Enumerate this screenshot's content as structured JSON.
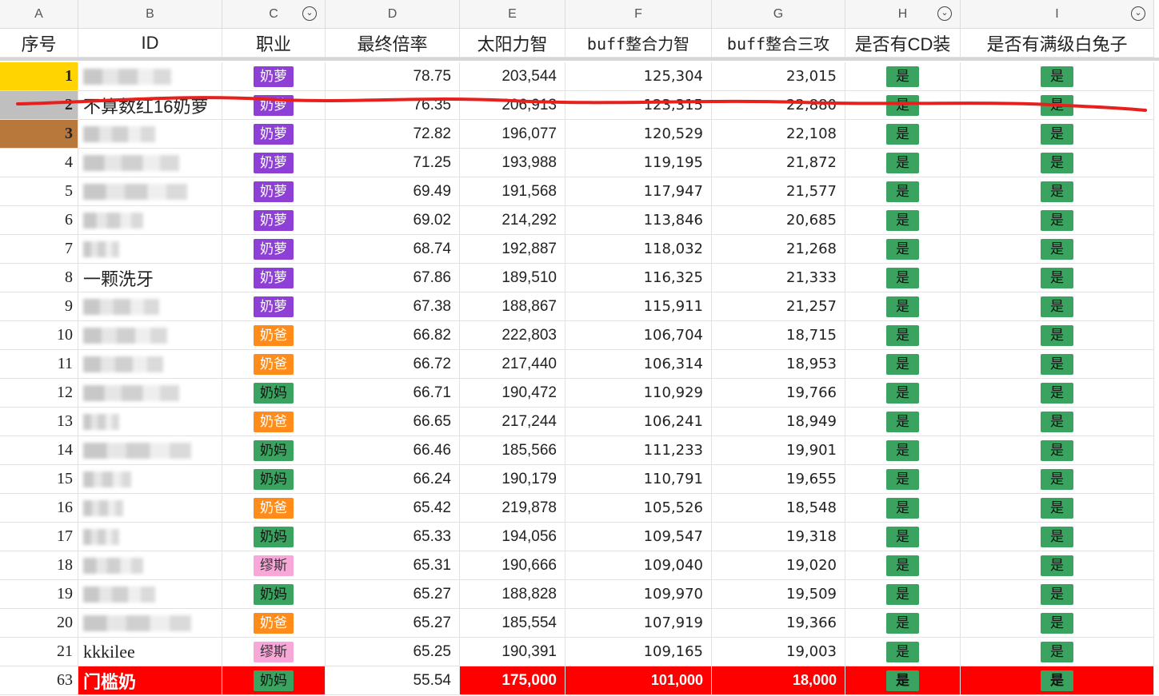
{
  "column_letters": [
    "A",
    "B",
    "C",
    "D",
    "E",
    "F",
    "G",
    "H",
    "I"
  ],
  "headers": [
    "序号",
    "ID",
    "职业",
    "最终倍率",
    "太阳力智",
    "buff整合力智",
    "buff整合三攻",
    "是否有CD装",
    "是否有满级白兔子"
  ],
  "filter_columns": [
    "C",
    "H",
    "I"
  ],
  "colors": {
    "rank1": "#ffd400",
    "rank2": "#bfbfbf",
    "rank3": "#b8783c",
    "job_nailuo": "#8e3fd6",
    "job_naiba": "#ff8c1a",
    "job_naima": "#3aa35f",
    "job_miusi": "#f7a8d8",
    "yes_green": "#3aa35f",
    "highlight_red": "#ff0000",
    "strike_line": "#e8201d"
  },
  "rows": [
    {
      "idx": "1",
      "id": "",
      "job": "奶萝",
      "job_color": "job_nailuo",
      "d": "78.75",
      "e": "203,544",
      "f": "125,304",
      "g": "23,015",
      "h": "是",
      "i": "是",
      "idx_bg": "rank1"
    },
    {
      "idx": "2",
      "id": "不算数红16奶萝",
      "job": "奶萝",
      "job_color": "job_nailuo",
      "d": "76.35",
      "e": "206,913",
      "f": "123,315",
      "g": "22,880",
      "h": "是",
      "i": "是",
      "idx_bg": "rank2"
    },
    {
      "idx": "3",
      "id": "",
      "job": "奶萝",
      "job_color": "job_nailuo",
      "d": "72.82",
      "e": "196,077",
      "f": "120,529",
      "g": "22,108",
      "h": "是",
      "i": "是",
      "idx_bg": "rank3"
    },
    {
      "idx": "4",
      "id": "",
      "job": "奶萝",
      "job_color": "job_nailuo",
      "d": "71.25",
      "e": "193,988",
      "f": "119,195",
      "g": "21,872",
      "h": "是",
      "i": "是"
    },
    {
      "idx": "5",
      "id": "",
      "job": "奶萝",
      "job_color": "job_nailuo",
      "d": "69.49",
      "e": "191,568",
      "f": "117,947",
      "g": "21,577",
      "h": "是",
      "i": "是"
    },
    {
      "idx": "6",
      "id": "",
      "job": "奶萝",
      "job_color": "job_nailuo",
      "d": "69.02",
      "e": "214,292",
      "f": "113,846",
      "g": "20,685",
      "h": "是",
      "i": "是"
    },
    {
      "idx": "7",
      "id": "",
      "job": "奶萝",
      "job_color": "job_nailuo",
      "d": "68.74",
      "e": "192,887",
      "f": "118,032",
      "g": "21,268",
      "h": "是",
      "i": "是"
    },
    {
      "idx": "8",
      "id": "一颗洗牙",
      "job": "奶萝",
      "job_color": "job_nailuo",
      "d": "67.86",
      "e": "189,510",
      "f": "116,325",
      "g": "21,333",
      "h": "是",
      "i": "是"
    },
    {
      "idx": "9",
      "id": "",
      "job": "奶萝",
      "job_color": "job_nailuo",
      "d": "67.38",
      "e": "188,867",
      "f": "115,911",
      "g": "21,257",
      "h": "是",
      "i": "是"
    },
    {
      "idx": "10",
      "id": "",
      "job": "奶爸",
      "job_color": "job_naiba",
      "d": "66.82",
      "e": "222,803",
      "f": "106,704",
      "g": "18,715",
      "h": "是",
      "i": "是"
    },
    {
      "idx": "11",
      "id": "",
      "job": "奶爸",
      "job_color": "job_naiba",
      "d": "66.72",
      "e": "217,440",
      "f": "106,314",
      "g": "18,953",
      "h": "是",
      "i": "是"
    },
    {
      "idx": "12",
      "id": "",
      "job": "奶妈",
      "job_color": "job_naima",
      "d": "66.71",
      "e": "190,472",
      "f": "110,929",
      "g": "19,766",
      "h": "是",
      "i": "是"
    },
    {
      "idx": "13",
      "id": "",
      "job": "奶爸",
      "job_color": "job_naiba",
      "d": "66.65",
      "e": "217,244",
      "f": "106,241",
      "g": "18,949",
      "h": "是",
      "i": "是"
    },
    {
      "idx": "14",
      "id": "",
      "job": "奶妈",
      "job_color": "job_naima",
      "d": "66.46",
      "e": "185,566",
      "f": "111,233",
      "g": "19,901",
      "h": "是",
      "i": "是"
    },
    {
      "idx": "15",
      "id": "",
      "job": "奶妈",
      "job_color": "job_naima",
      "d": "66.24",
      "e": "190,179",
      "f": "110,791",
      "g": "19,655",
      "h": "是",
      "i": "是"
    },
    {
      "idx": "16",
      "id": "",
      "job": "奶爸",
      "job_color": "job_naiba",
      "d": "65.42",
      "e": "219,878",
      "f": "105,526",
      "g": "18,548",
      "h": "是",
      "i": "是"
    },
    {
      "idx": "17",
      "id": "",
      "job": "奶妈",
      "job_color": "job_naima",
      "d": "65.33",
      "e": "194,056",
      "f": "109,547",
      "g": "19,318",
      "h": "是",
      "i": "是"
    },
    {
      "idx": "18",
      "id": "",
      "job": "缪斯",
      "job_color": "job_miusi",
      "d": "65.31",
      "e": "190,666",
      "f": "109,040",
      "g": "19,020",
      "h": "是",
      "i": "是"
    },
    {
      "idx": "19",
      "id": "",
      "job": "奶妈",
      "job_color": "job_naima",
      "d": "65.27",
      "e": "188,828",
      "f": "109,970",
      "g": "19,509",
      "h": "是",
      "i": "是"
    },
    {
      "idx": "20",
      "id": "",
      "job": "奶爸",
      "job_color": "job_naiba",
      "d": "65.27",
      "e": "185,554",
      "f": "107,919",
      "g": "19,366",
      "h": "是",
      "i": "是"
    },
    {
      "idx": "21",
      "id": "kkkilee",
      "job": "缪斯",
      "job_color": "job_miusi",
      "d": "65.25",
      "e": "190,391",
      "f": "109,165",
      "g": "19,003",
      "h": "是",
      "i": "是"
    },
    {
      "idx": "63",
      "id": "门槛奶",
      "job": "奶妈",
      "job_color": "job_naima",
      "d": "55.54",
      "e": "175,000",
      "f": "101,000",
      "g": "18,000",
      "h": "是",
      "i": "是",
      "highlight": true
    }
  ]
}
